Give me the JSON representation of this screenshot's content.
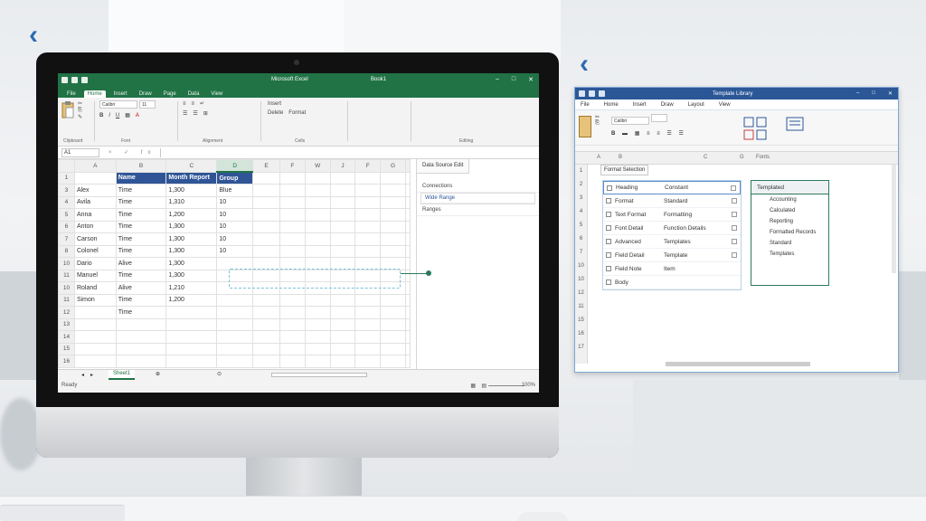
{
  "nav": {
    "back_left": "‹",
    "back_right": "‹"
  },
  "excel": {
    "window": {
      "title": "Microsoft Excel",
      "doc_name": "Book1"
    },
    "tabs": [
      "File",
      "Home",
      "Insert",
      "Draw",
      "Page",
      "Data",
      "View"
    ],
    "ribbon": {
      "font_name": "Calibri",
      "font_size": "11",
      "groups": [
        "Clipboard",
        "Font",
        "Alignment",
        "Cells",
        "Editing"
      ],
      "cells_buttons": [
        "Insert",
        "Delete",
        "Format"
      ]
    },
    "formula_bar": {
      "name_box": "A1",
      "icons": "× ✓ fx"
    },
    "columns": [
      "A",
      "B",
      "C",
      "D",
      "E",
      "F",
      "W",
      "J",
      "F",
      "G",
      "U"
    ],
    "header_row": {
      "a": "",
      "b": "Name",
      "c": "Month Report",
      "d": "Group"
    },
    "rows": [
      {
        "n": "1",
        "a": "",
        "b": "Name",
        "c": "Month Report",
        "d": "Group"
      },
      {
        "n": "3",
        "a": "Alex",
        "b": "Time",
        "c": "1,300",
        "d": "Blue"
      },
      {
        "n": "4",
        "a": "Avila",
        "b": "Time",
        "c": "1,310",
        "d": "10"
      },
      {
        "n": "5",
        "a": "Anna",
        "b": "Time",
        "c": "1,200",
        "d": "10"
      },
      {
        "n": "6",
        "a": "Anton",
        "b": "Time",
        "c": "1,300",
        "d": "10"
      },
      {
        "n": "7",
        "a": "Carson",
        "b": "Time",
        "c": "1,300",
        "d": "10"
      },
      {
        "n": "8",
        "a": "Colonel",
        "b": "Time",
        "c": "1,300",
        "d": "10"
      },
      {
        "n": "10",
        "a": "Dario",
        "b": "Alive",
        "c": "1,300",
        "d": ""
      },
      {
        "n": "11",
        "a": "Manuel",
        "b": "Time",
        "c": "1,300",
        "d": ""
      },
      {
        "n": "10",
        "a": "Roland",
        "b": "Alive",
        "c": "1,210",
        "d": ""
      },
      {
        "n": "11",
        "a": "Simon",
        "b": "Time",
        "c": "1,200",
        "d": ""
      },
      {
        "n": "12",
        "a": "",
        "b": "Time",
        "c": "",
        "d": ""
      },
      {
        "n": "13",
        "a": "",
        "b": "",
        "c": "",
        "d": ""
      },
      {
        "n": "14",
        "a": "",
        "b": "",
        "c": "",
        "d": ""
      },
      {
        "n": "15",
        "a": "",
        "b": "",
        "c": "",
        "d": ""
      },
      {
        "n": "16",
        "a": "",
        "b": "",
        "c": "",
        "d": ""
      }
    ],
    "side_panel": {
      "tab": "Data Source Edit",
      "row1": "Connections",
      "item1": "Wide Range",
      "row2": "Ranges"
    },
    "sheet_tab": "Sheet1",
    "status": {
      "left": "Ready",
      "zoom": "100%"
    }
  },
  "word": {
    "window": {
      "title": "Template Library"
    },
    "menu": [
      "File",
      "Home",
      "Insert",
      "Draw",
      "Layout",
      "View"
    ],
    "ribbon": {
      "font_name": "Calibri"
    },
    "ruler": [
      "A",
      "B",
      "C",
      "G",
      "Fonts"
    ],
    "rows": [
      "1",
      "2",
      "3",
      "4",
      "5",
      "6",
      "7",
      "10",
      "10",
      "12",
      "11",
      "15",
      "16",
      "17"
    ],
    "panel_header": "Format Selection",
    "items": [
      {
        "label": "Heading",
        "value": "Constant"
      },
      {
        "label": "Format",
        "value": "Standard"
      },
      {
        "label": "Text Format",
        "value": "Formatting"
      },
      {
        "label": "Font Detail",
        "value": "Function Details"
      },
      {
        "label": "Advanced",
        "value": "Templates"
      },
      {
        "label": "Field Detail",
        "value": "Template"
      },
      {
        "label": "Field Note",
        "value": "Item"
      },
      {
        "label": "Body",
        "value": ""
      }
    ],
    "right_panel": {
      "header": "Templated",
      "items": [
        "Accounting",
        "Calculated",
        "Reporting",
        "Formatted Records",
        "Standard",
        "Templates"
      ]
    }
  },
  "colors": {
    "excel_green": "#217346",
    "word_blue": "#2b5797",
    "header_blue": "#2f5597"
  }
}
